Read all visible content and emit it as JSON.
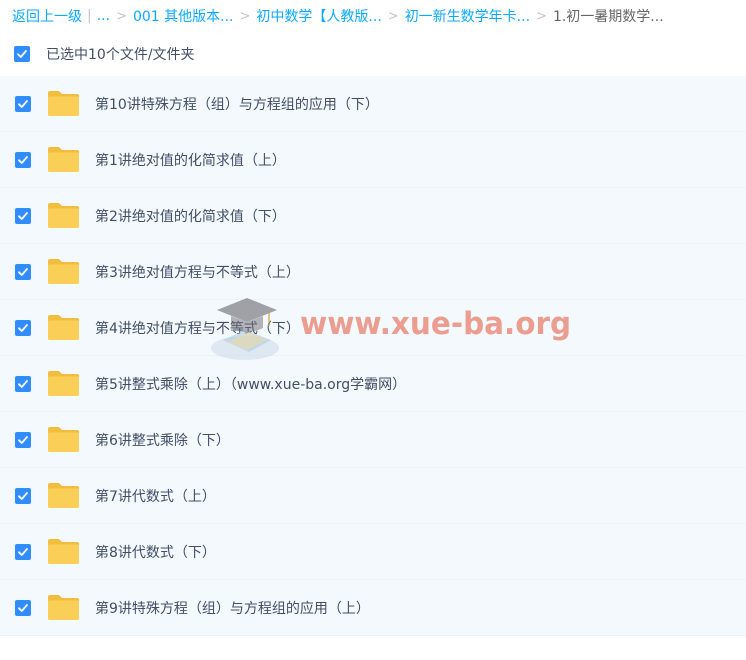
{
  "breadcrumb": {
    "back": "返回上一级",
    "ellipsis": "...",
    "items": [
      "001 其他版本...",
      "初中数学【人教版...",
      "初一新生数学年卡..."
    ],
    "current": "1.初一暑期数学..."
  },
  "select_all": {
    "label": "已选中10个文件/文件夹",
    "checked": true
  },
  "files": [
    {
      "name": "第10讲特殊方程（组）与方程组的应用（下）",
      "checked": true
    },
    {
      "name": "第1讲绝对值的化简求值（上）",
      "checked": true
    },
    {
      "name": "第2讲绝对值的化简求值（下）",
      "checked": true
    },
    {
      "name": "第3讲绝对值方程与不等式（上）",
      "checked": true
    },
    {
      "name": "第4讲绝对值方程与不等式（下）",
      "checked": true
    },
    {
      "name": "第5讲整式乘除（上）（www.xue-ba.org学霸网）",
      "checked": true
    },
    {
      "name": "第6讲整式乘除（下）",
      "checked": true
    },
    {
      "name": "第7讲代数式（上）",
      "checked": true
    },
    {
      "name": "第8讲代数式（下）",
      "checked": true
    },
    {
      "name": "第9讲特殊方程（组）与方程组的应用（上）",
      "checked": true
    }
  ],
  "watermark": {
    "text": "www.xue-ba.org"
  },
  "colors": {
    "accent": "#09aaff",
    "checkbox": "#2f8dff",
    "folder": "#f7c843",
    "row_bg": "#f4f9fe"
  },
  "icons": {
    "folder": "folder-icon",
    "check": "checkmark-icon"
  }
}
